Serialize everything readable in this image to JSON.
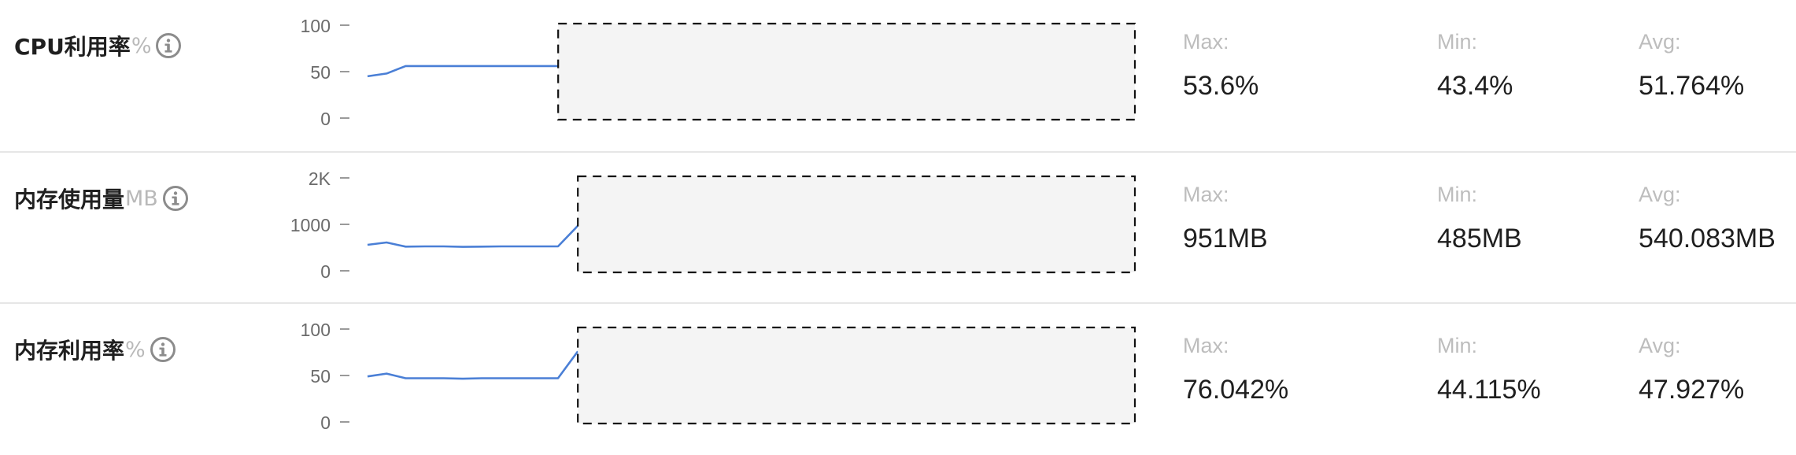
{
  "metrics": [
    {
      "title": "CPU利用率",
      "unit": "%",
      "y_ticks": [
        "100",
        "50",
        "0"
      ],
      "y_max": 100,
      "series": [
        45,
        48,
        56,
        56,
        56,
        56,
        56,
        56,
        56,
        56,
        56,
        55
      ],
      "series_points_total": 12,
      "no_data_from_index": 11,
      "stats": {
        "max_label": "Max:",
        "max": "53.6%",
        "min_label": "Min:",
        "min": "43.4%",
        "avg_label": "Avg:",
        "avg": "51.764%"
      }
    },
    {
      "title": "内存使用量",
      "unit": "MB",
      "y_ticks": [
        "2K",
        "1000",
        "0"
      ],
      "y_max": 2000,
      "series": [
        560,
        610,
        520,
        525,
        525,
        515,
        520,
        525,
        525,
        525,
        525,
        970
      ],
      "series_points_total": 12,
      "no_data_from_index": 11,
      "stats": {
        "max_label": "Max:",
        "max": "951MB",
        "min_label": "Min:",
        "min": "485MB",
        "avg_label": "Avg:",
        "avg": "540.083MB"
      }
    },
    {
      "title": "内存利用率",
      "unit": "%",
      "y_ticks": [
        "100",
        "50",
        "0"
      ],
      "y_max": 100,
      "series": [
        49,
        52,
        47,
        47,
        47,
        46.5,
        47,
        47,
        47,
        47,
        47,
        76
      ],
      "series_points_total": 12,
      "no_data_from_index": 11,
      "stats": {
        "max_label": "Max:",
        "max": "76.042%",
        "min_label": "Min:",
        "min": "44.115%",
        "avg_label": "Avg:",
        "avg": "47.927%"
      }
    }
  ],
  "colors": {
    "line": "#4a7fd6",
    "axis_text": "#6b6b6b",
    "tick": "#9a9a9a",
    "no_data_fill": "#f4f4f4",
    "no_data_border": "#111111",
    "info_icon": "#8c8c8c"
  },
  "icons": {
    "info": "info-circle-icon"
  }
}
